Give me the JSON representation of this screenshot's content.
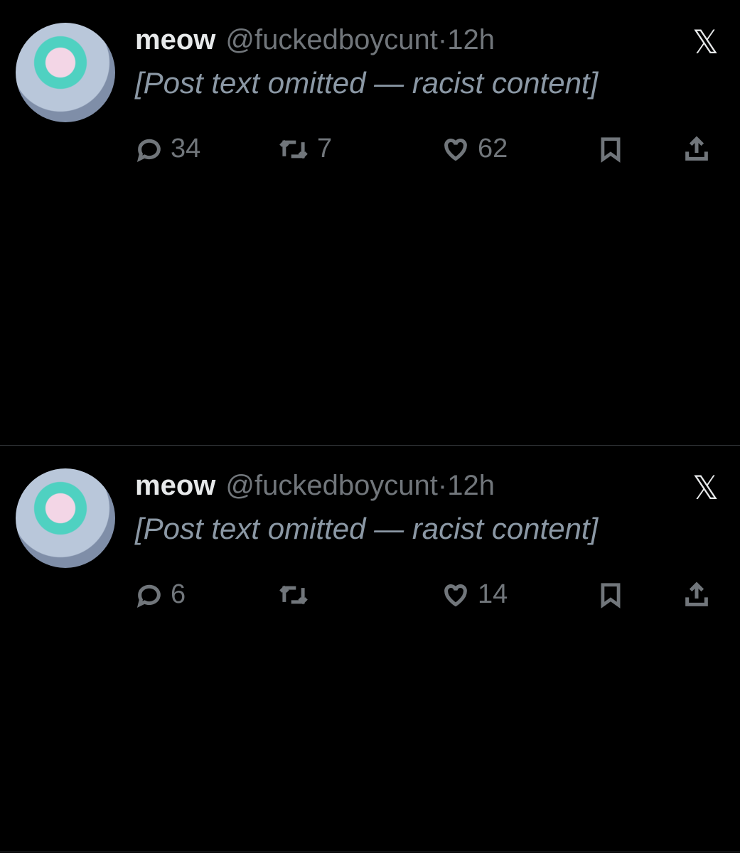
{
  "posts": [
    {
      "name": "meow",
      "handle": "@fuckedboycunt",
      "dot": "·",
      "time": "12h",
      "body": "[Post text omitted — racist content]",
      "replies": "34",
      "reposts": "7",
      "likes": "62"
    },
    {
      "name": "meow",
      "handle": "@fuckedboycunt",
      "dot": "·",
      "time": "12h",
      "body": "[Post text omitted — racist content]",
      "replies": "6",
      "reposts": "",
      "likes": "14"
    }
  ],
  "icons": {
    "platform": "x-logo-icon"
  },
  "colors": {
    "background": "#000000",
    "text": "#e7e9ea",
    "muted": "#71767b",
    "divider": "#2f3336"
  }
}
